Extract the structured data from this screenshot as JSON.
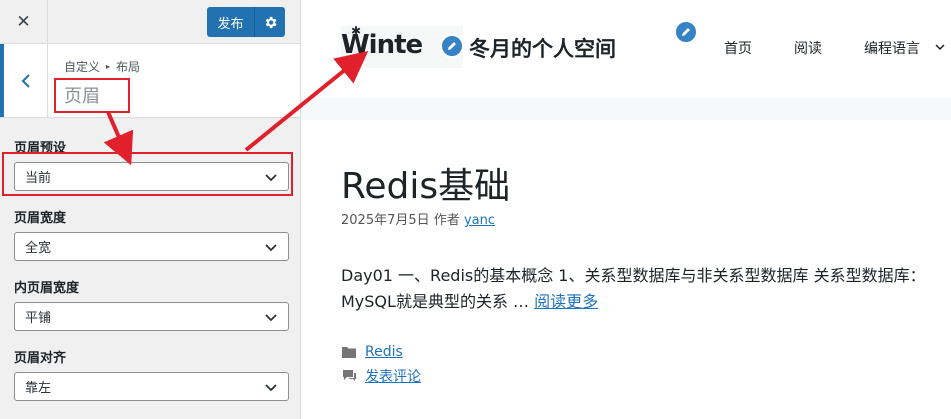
{
  "sidebar": {
    "close_label": "✕",
    "publish_label": "发布",
    "breadcrumb": {
      "root": "自定义",
      "section": "布局"
    },
    "section_title": "页眉",
    "controls": [
      {
        "label": "页眉预设",
        "value": "当前"
      },
      {
        "label": "页眉宽度",
        "value": "全宽"
      },
      {
        "label": "内页眉宽度",
        "value": "平铺"
      },
      {
        "label": "页眉对齐",
        "value": "靠左"
      }
    ]
  },
  "preview": {
    "logo_text": "Winte",
    "site_title": "冬月的个人空间",
    "nav": [
      "首页",
      "阅读",
      "编程语言"
    ],
    "post": {
      "title": "Redis基础",
      "date": "2025年7月5日",
      "author_prefix": "作者",
      "author": "yanc",
      "excerpt": "Day01 一、Redis的基本概念 1、关系型数据库与非关系型数据库 关系型数据库：MySQL就是典型的关系 …",
      "read_more": "阅读更多",
      "category": "Redis",
      "comment": "发表评论"
    }
  },
  "colors": {
    "accent": "#2271b1",
    "link": "#1e73be",
    "annotation": "#e0202a"
  }
}
